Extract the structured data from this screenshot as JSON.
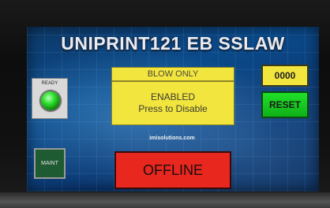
{
  "header": {
    "title": "UNIPRINT121 EB SSLAW"
  },
  "status": {
    "ready_label": "READY",
    "ready_indicator_color": "#2ee02e",
    "connection": "OFFLINE",
    "connection_color": "#e8271f"
  },
  "mode": {
    "label": "BLOW ONLY",
    "state_line1": "ENABLED",
    "state_line2": "Press to Disable",
    "color": "#f2e53e"
  },
  "counter": {
    "value": "0000"
  },
  "buttons": {
    "reset_label": "RESET",
    "reset_color": "#1fe028",
    "maint_label": "MAINT"
  },
  "branding": {
    "url": "imisolutions.com"
  }
}
